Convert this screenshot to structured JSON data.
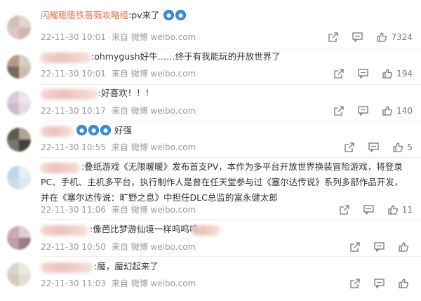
{
  "comments": [
    {
      "top": 0,
      "avatar": [
        "#cfb9b1",
        "#e3cfc7",
        "#d9c2ba",
        "#cbb1a8"
      ],
      "username": "闪耀暖暖铁蔷薇攻略组",
      "text": ":pv来了",
      "emojis": [
        "doraemon-emoji",
        "doraemon-emoji"
      ],
      "date": "22-11-30 10:01",
      "source": "来自 微博 weibo.com",
      "likes": "7324"
    },
    {
      "top": 0,
      "avatar": [
        "#ad8e78",
        "#d2cab6",
        "#6a5a4e",
        "#c8b9a4"
      ],
      "text": ":ohmygush好牛……终于有我能玩的开放世界了",
      "date": "22-11-30 10:01",
      "source": "来自 微博 weibo.com",
      "likes": "194"
    },
    {
      "top": 0,
      "avatar": [
        "#d9c6d6",
        "#ece2ea",
        "#c9b3c6",
        "#e5d7e2"
      ],
      "text": ":好喜欢！！！",
      "date": "22-11-30 10:17",
      "source": "来自 微博 weibo.com",
      "likes": "140"
    },
    {
      "top": 0,
      "avatar": [
        "#4d4a3f",
        "#a89a86",
        "#6d665a",
        "#2f2c27"
      ],
      "text": "好强",
      "emojis": [
        "doraemon-emoji",
        "doraemon-emoji",
        "doraemon-emoji"
      ],
      "date": "22-11-30 10:55",
      "source": "来自 微博 weibo.com",
      "likes": "5"
    },
    {
      "top": 0,
      "avatar": [
        "#b8d2e6",
        "#e3eef6",
        "#c3d9ea",
        "#d6e6f2"
      ],
      "text": ":叠纸游戏《无限暖暖》发布首支PV，本作为多平台开放世界换装冒险游戏，将登录PC、手机、主机多平台，执行制作人是曾在任天堂参与过《塞尔达传说》系列多部作品开发，并在《塞尔达传说：旷野之息》中担任DLC总监的富永健太郎",
      "date": "22-11-30 11:06",
      "source": "来自 微博 weibo.com",
      "likes": "11"
    },
    {
      "top": 0,
      "avatar": [
        "#c4a3a8",
        "#dccbd0",
        "#b5949b",
        "#8c6f76"
      ],
      "text": ":像芭比梦游仙境一样呜呜呜",
      "date": "22-11-30 10:50",
      "source": "来自 微博 weibo.com",
      "likes": ""
    },
    {
      "top": 0,
      "avatar": [
        "#d8d0c4",
        "#ebe6de",
        "#cfc5b7",
        "#e2dbd1"
      ],
      "text": ":魔，魔幻起来了",
      "date": "22-11-30 11:03",
      "source": "来自 微博 weibo.com",
      "likes": ""
    }
  ]
}
